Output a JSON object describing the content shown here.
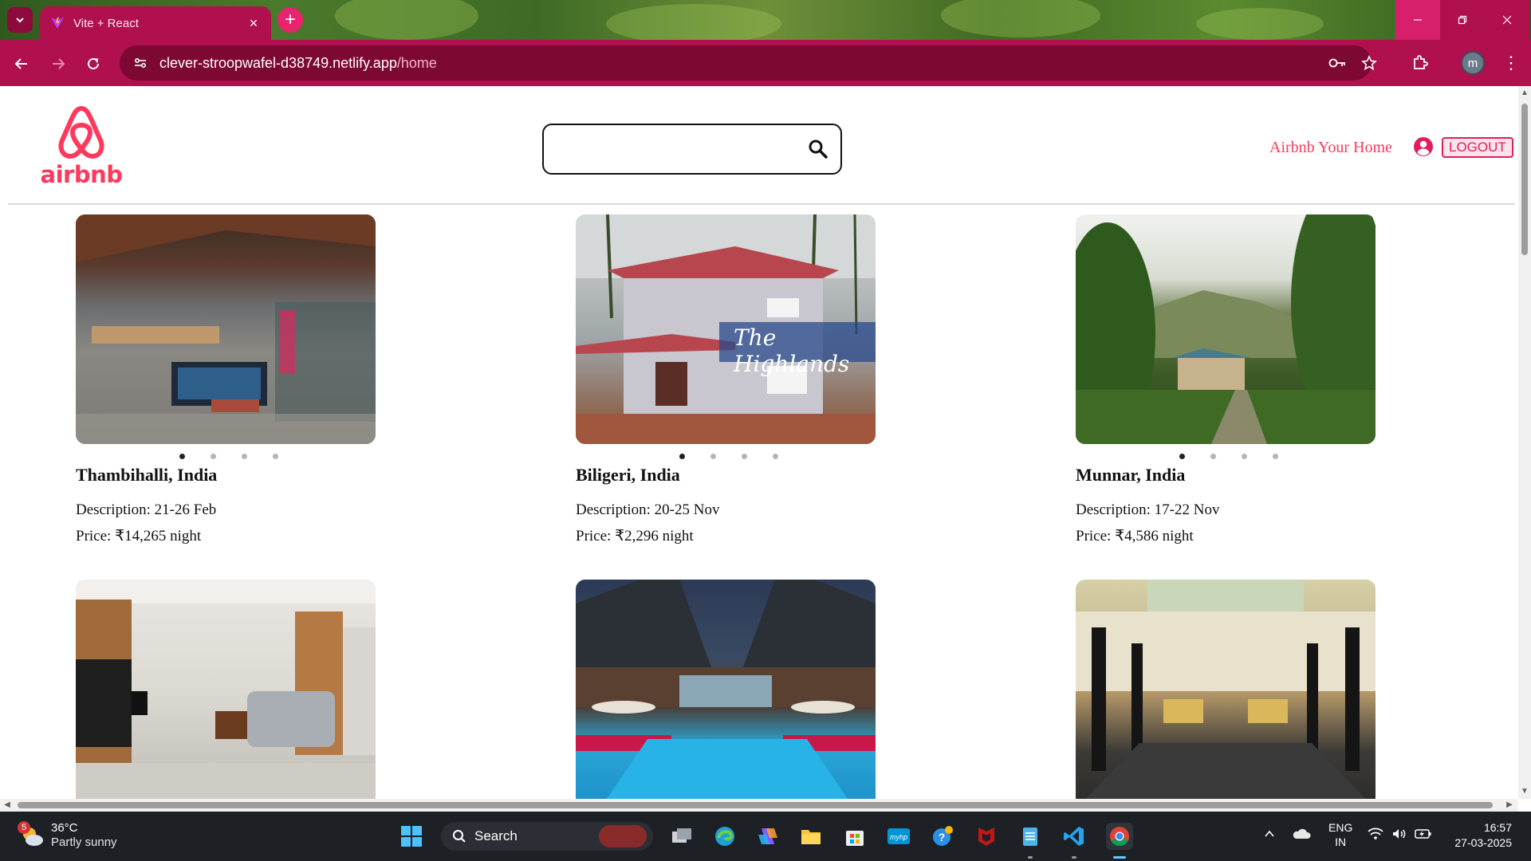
{
  "browser": {
    "tab_title": "Vite + React",
    "url_host": "clever-stroopwafel-d38749.netlify.app",
    "url_path": "/home",
    "profile_initial": "m"
  },
  "header": {
    "logo_text": "airbnb",
    "search": {
      "value": "",
      "placeholder": ""
    },
    "host_link": "Airbnb Your Home",
    "logout_label": "LOGOUT"
  },
  "listings": [
    {
      "location": "Thambihalli, India",
      "description": "Description: 21-26 Feb",
      "price": "Price: ₹14,265 night",
      "active_slide": 0,
      "slides": 4
    },
    {
      "location": "Biligeri, India",
      "description": "Description: 20-25 Nov",
      "price": "Price: ₹2,296 night",
      "active_slide": 0,
      "slides": 4,
      "image_caption": "The Highlands"
    },
    {
      "location": "Munnar, India",
      "description": "Description: 17-22 Nov",
      "price": "Price: ₹4,586 night",
      "active_slide": 0,
      "slides": 4
    },
    {
      "location": "",
      "description": "",
      "price": ""
    },
    {
      "location": "",
      "description": "",
      "price": ""
    },
    {
      "location": "",
      "description": "",
      "price": ""
    }
  ],
  "taskbar": {
    "weather_badge": "5",
    "temperature": "36°C",
    "condition": "Partly sunny",
    "search_label": "Search",
    "language_line1": "ENG",
    "language_line2": "IN",
    "time": "16:57",
    "date": "27-03-2025"
  },
  "colors": {
    "brand": "#ff385c",
    "chrome_toolbar": "#b0104e",
    "taskbar": "#1d2024"
  }
}
